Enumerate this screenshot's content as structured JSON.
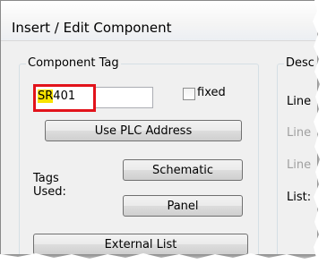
{
  "window": {
    "title": "Insert / Edit Component"
  },
  "component_tag": {
    "group_label": "Component Tag",
    "tag_prefix": "SR",
    "tag_suffix": "401",
    "fixed_label": "fixed",
    "fixed_checked": false,
    "use_plc_button": "Use PLC Address",
    "tags_used_label_line1": "Tags",
    "tags_used_label_line2": "Used:",
    "schematic_button": "Schematic",
    "panel_button": "Panel",
    "external_list_button": "External List"
  },
  "description": {
    "group_label_partial": "Desc",
    "lines": [
      "Line",
      "Line",
      "Line"
    ],
    "list_label": "List:"
  },
  "colors": {
    "highlight_border": "#e2131b",
    "highlight_fill": "#f8e200"
  }
}
